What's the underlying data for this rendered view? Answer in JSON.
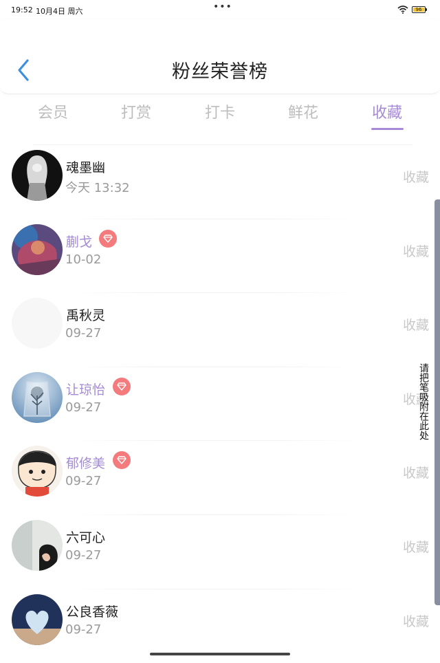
{
  "status_bar": {
    "time": "19:52",
    "date": "10月4日 周六",
    "dots": "•••",
    "battery": "96"
  },
  "header": {
    "title": "粉丝荣誉榜"
  },
  "tabs": [
    {
      "label": "会员"
    },
    {
      "label": "打赏"
    },
    {
      "label": "打卡"
    },
    {
      "label": "鲜花"
    },
    {
      "label": "收藏"
    }
  ],
  "active_tab": "收藏",
  "colors": {
    "accent": "#a68ad8",
    "vip_name": "#a58bd4",
    "gem_badge": "#f37a7d",
    "secondary_text": "#9a9a9a",
    "action_text": "#c8c8c8"
  },
  "list": [
    {
      "name": "魂墨幽",
      "time": "今天 13:32",
      "action": "收藏",
      "vip": false
    },
    {
      "name": "蒯戈",
      "time": "10-02",
      "action": "收藏",
      "vip": true
    },
    {
      "name": "禹秋灵",
      "time": "09-27",
      "action": "收藏",
      "vip": false
    },
    {
      "name": "让琼怡",
      "time": "09-27",
      "action": "收藏",
      "vip": true
    },
    {
      "name": "郁修美",
      "time": "09-27",
      "action": "收藏",
      "vip": true
    },
    {
      "name": "六可心",
      "time": "09-27",
      "action": "收藏",
      "vip": false
    },
    {
      "name": "公良香薇",
      "time": "09-27",
      "action": "收藏",
      "vip": false
    }
  ],
  "pen_dock": {
    "hint": "请把笔吸附在此处"
  }
}
